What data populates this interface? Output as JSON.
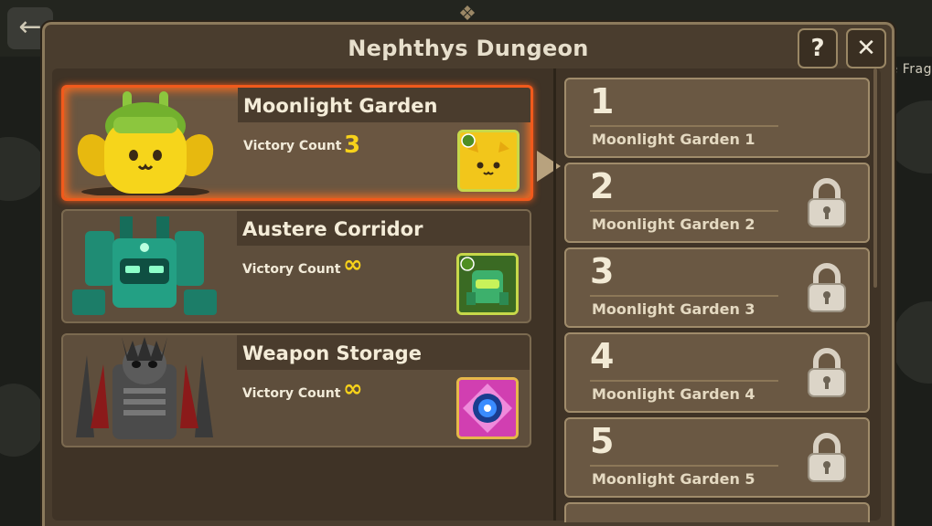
{
  "background": {
    "back_icon": "arrow-left-icon",
    "back_glyph": "←",
    "frag_text": "e Frag"
  },
  "window": {
    "title": "Nephthys Dungeon",
    "help_label": "?",
    "close_label": "✕",
    "accent": "#f15a1c"
  },
  "dungeons": [
    {
      "name": "Moonlight Garden",
      "victory_label": "Victory Count",
      "victory_value": "3",
      "selected": true
    },
    {
      "name": "Austere Corridor",
      "victory_label": "Victory Count",
      "victory_value": "∞",
      "selected": false
    },
    {
      "name": "Weapon Storage",
      "victory_label": "Victory Count",
      "victory_value": "∞",
      "selected": false
    }
  ],
  "stages": [
    {
      "number": "1",
      "name": "Moonlight Garden 1",
      "locked": false
    },
    {
      "number": "2",
      "name": "Moonlight Garden 2",
      "locked": true
    },
    {
      "number": "3",
      "name": "Moonlight Garden 3",
      "locked": true
    },
    {
      "number": "4",
      "name": "Moonlight Garden 4",
      "locked": true
    },
    {
      "number": "5",
      "name": "Moonlight Garden 5",
      "locked": true
    }
  ]
}
